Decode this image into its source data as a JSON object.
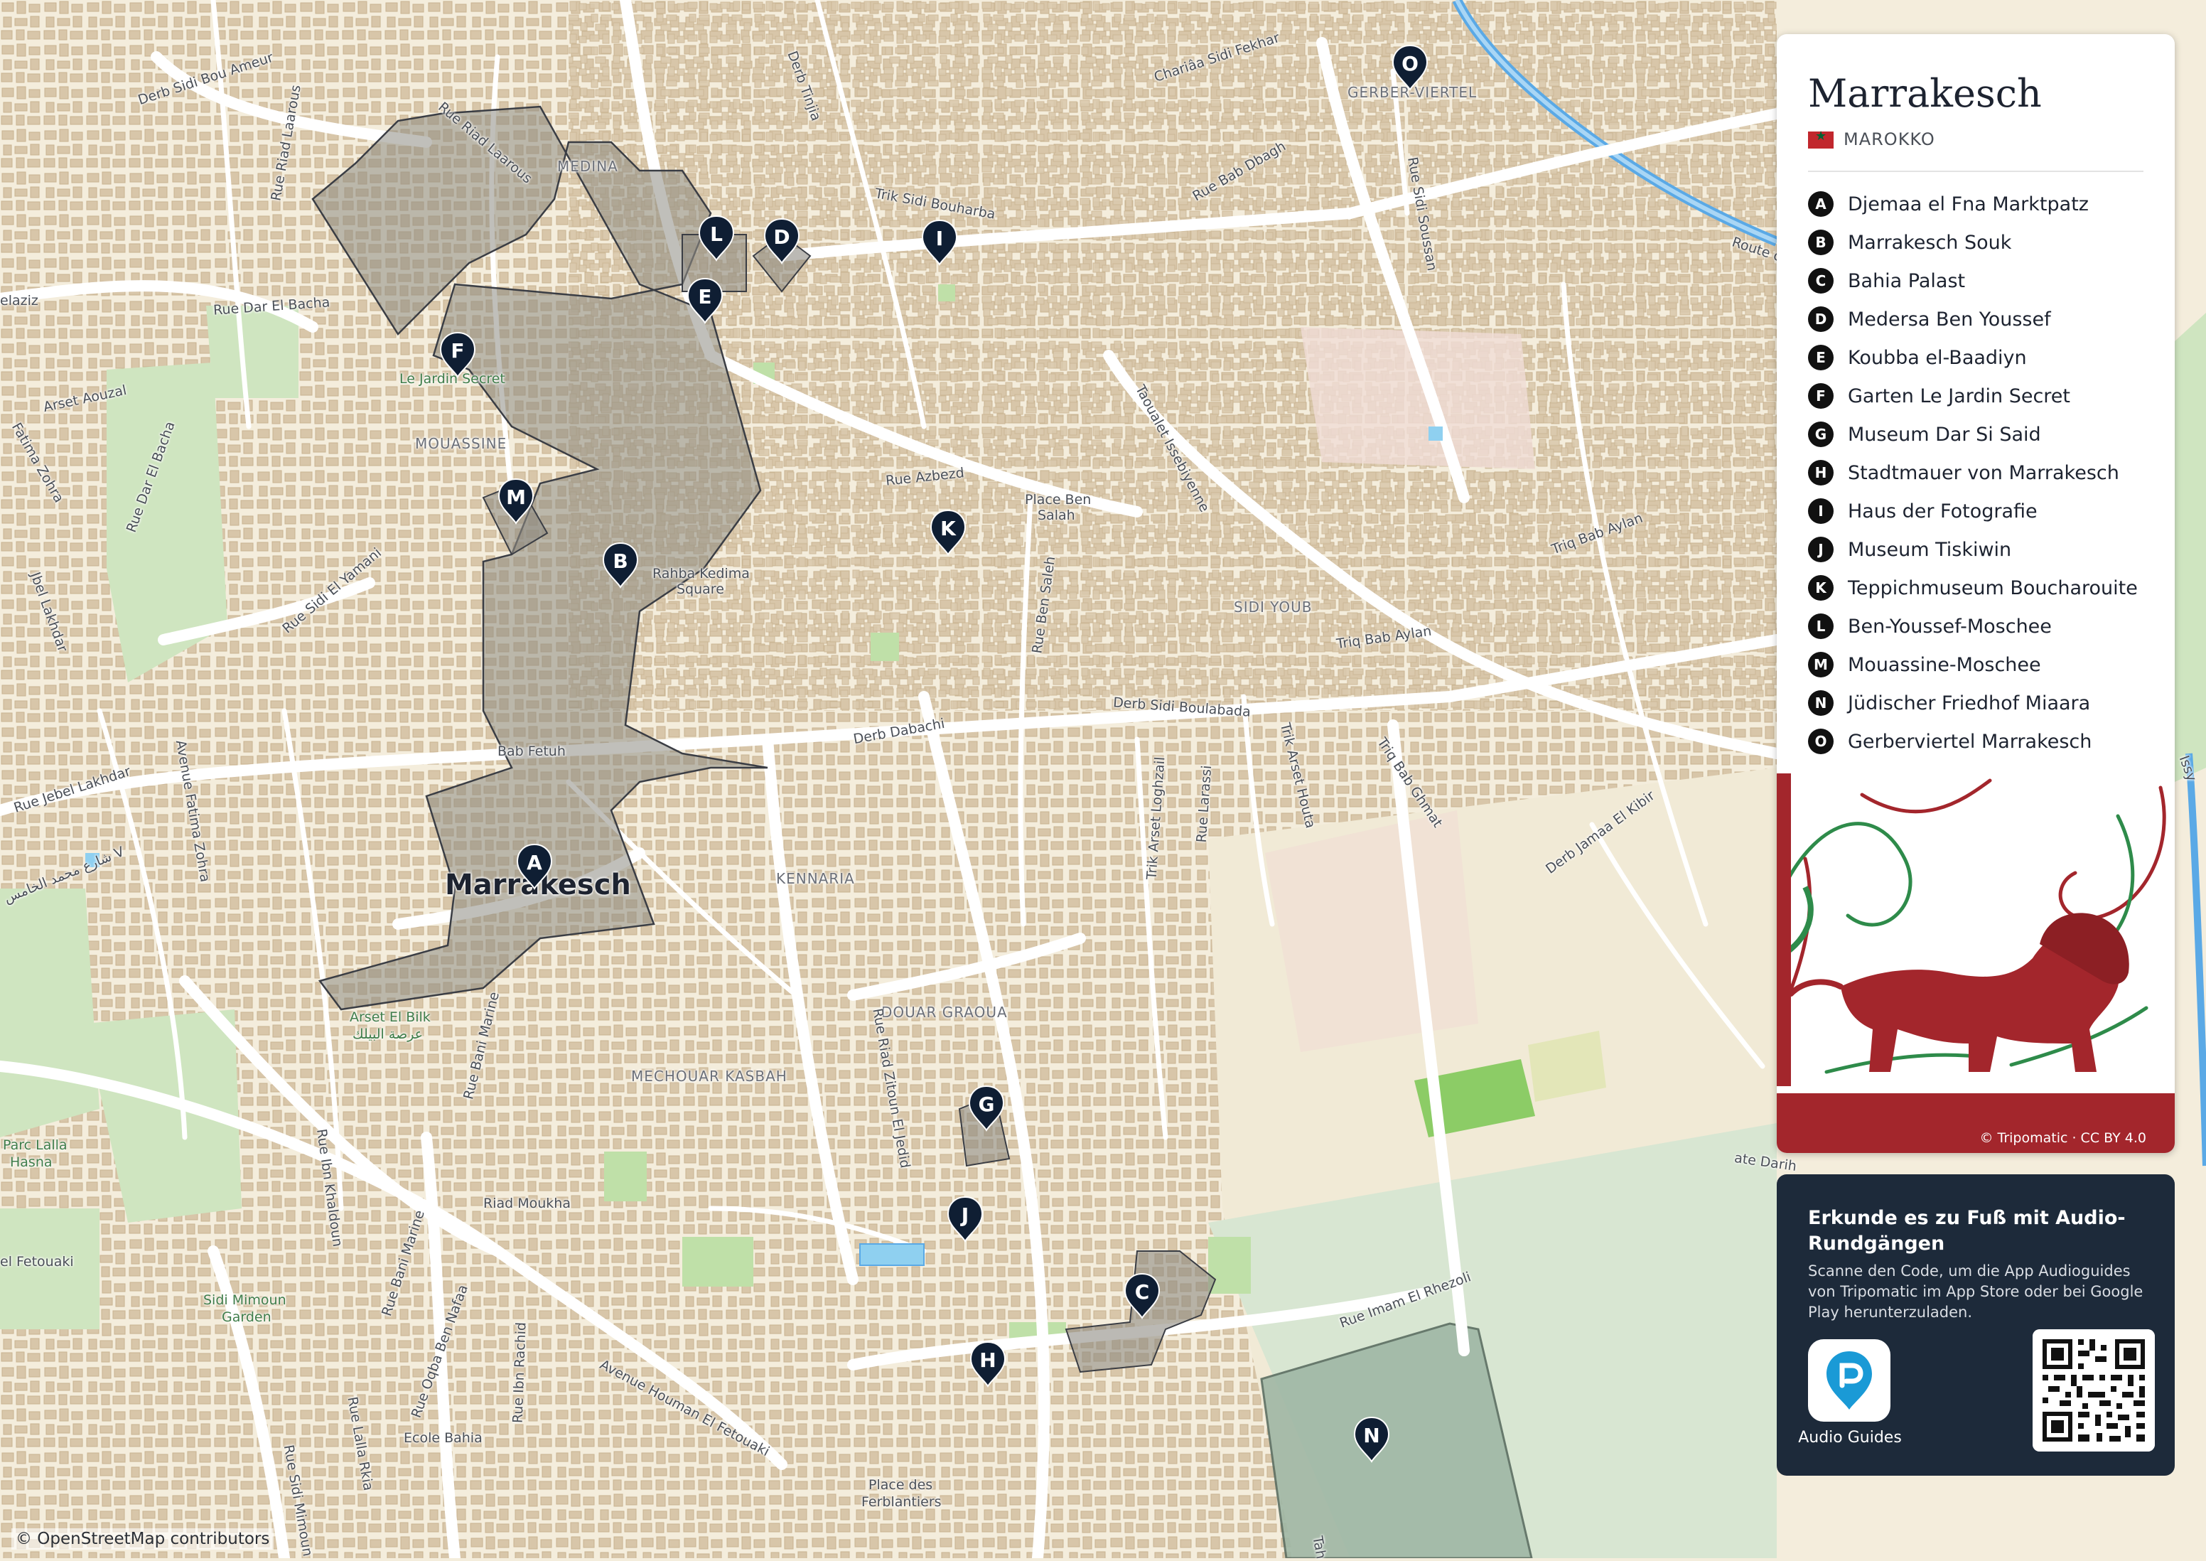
{
  "colors": {
    "land": "#f4eddc",
    "building": "#d5c1a3",
    "road": "#ffffff",
    "park": "#cfe5c0",
    "water": "#8fd0f0",
    "river": "#5aa9e6",
    "highlight_area": "#8d8a82",
    "cemetery": "#9fb7a5",
    "pin": "#0f1e33",
    "promo_bg": "#1d2a3a",
    "flag": "#c1272d"
  },
  "title": "Marrakesch",
  "country": "MAROKKO",
  "city_label": "Marrakesch",
  "pois": [
    {
      "letter": "A",
      "name": "Djemaa el Fna Marktpatz"
    },
    {
      "letter": "B",
      "name": "Marrakesch Souk"
    },
    {
      "letter": "C",
      "name": "Bahia Palast"
    },
    {
      "letter": "D",
      "name": "Medersa Ben Youssef"
    },
    {
      "letter": "E",
      "name": "Koubba el-Baadiyn"
    },
    {
      "letter": "F",
      "name": "Garten Le Jardin Secret"
    },
    {
      "letter": "G",
      "name": "Museum Dar Si Said"
    },
    {
      "letter": "H",
      "name": "Stadtmauer von Marrakesch"
    },
    {
      "letter": "I",
      "name": "Haus der Fotografie"
    },
    {
      "letter": "J",
      "name": "Museum Tiskiwin"
    },
    {
      "letter": "K",
      "name": "Teppichmuseum Boucharouite"
    },
    {
      "letter": "L",
      "name": "Ben-Youssef-Moschee"
    },
    {
      "letter": "M",
      "name": "Mouassine-Moschee"
    },
    {
      "letter": "N",
      "name": "Jüdischer Friedhof Miaara"
    },
    {
      "letter": "O",
      "name": "Gerberviertel Marrakesch"
    }
  ],
  "map_labels": {
    "medina": "MEDINA",
    "mouassine": "MOUASSINE",
    "sidi_youb": "SIDI YOUB",
    "kennaria": "KENNARIA",
    "douar_graoua": "DOUAR GRAOUA",
    "mechouar_kasbah": "MECHOUAR KASBAH",
    "gerber_viertel": "GERBER-VIERTEL",
    "le_jardin_secret": "Le Jardin Secret",
    "rahba_kedima_1": "Rahba Kedima",
    "rahba_kedima_2": "Square",
    "bab_fetuh": "Bab Fetuh",
    "arset_el_bilk": "Arset El Bilk",
    "arset_el_bilk_ar": "عرصة البيلك",
    "parc_lalla_hasna_1": "Parc Lalla",
    "parc_lalla_hasna_2": "Hasna",
    "riad_moukha": "Riad Moukha",
    "sidi_mimoun_garden_1": "Sidi Mimoun",
    "sidi_mimoun_garden_2": "Garden",
    "ecole_bahia": "Ecole Bahia",
    "place_des_ferblantiers_1": "Place des",
    "place_des_ferblantiers_2": "Ferblantiers",
    "place_ben_salah_1": "Place Ben",
    "place_ben_salah_2": "Salah",
    "derb_sidi_bou_ameur": "Derb Sidi Bou Ameur",
    "rue_riad_laarous": "Rue Riad Laarous",
    "rue_riad_laarous_2": "Rue Riad Laarous",
    "derb_tinjia": "Derb Tinjia",
    "chariaa_sidi_fekhar": "Chariâa Sidi Fekhar",
    "rue_bab_dbagh": "Rue Bab Dbagh",
    "trik_sidi_bouharba": "Trik Sidi Bouharba",
    "rue_sidi_soussan": "Rue Sidi Soussan",
    "route": "Route c",
    "rue_dar_el_bacha": "Rue Dar El Bacha",
    "elaziz": "elaziz",
    "arset_aouzal": "Arset Aouzal",
    "fatima_zohra": "Fatima Zohra",
    "rue_dar_el_bacha_2": "Rue Dar El Bacha",
    "jbel_lakhdar": "Jbel Lakhdar",
    "rue_sidi_el_yamani": "Rue Sidi El Yamani",
    "rue_azbezd": "Rue Azbezd",
    "taoualet_issebiyenne": "Taoualet Issebiyenne",
    "triq_bab_aylan": "Triq Bab Aylan",
    "triq_bab_aylan_2": "Triq Bab Aylan",
    "rue_ben_saleh": "Rue Ben Saleh",
    "derb_sidi_boulabada": "Derb Sidi Boulabada",
    "derb_dabachi": "Derb Dabachi",
    "rue_jebel_lakhdar": "Rue Jebel Lakhdar",
    "avenue_fatima_zohra": "Avenue Fatima Zohra",
    "arabic_street": "شارع محمد الخامس V",
    "trik_arset_loghzail": "Trik Arset Loghzail",
    "rue_larassi": "Rue Larassi",
    "trik_arset_houta": "Trik Arset Houta",
    "triq_bab_ghmat": "Triq Bab Ghmat",
    "derb_jamaa_el_kibir": "Derb Jamaa El Kibir",
    "rue_bani_marine": "Rue Bani Marine",
    "rue_riad_zitoun_el_jedid": "Rue Riad Zitoun El Jedid",
    "rue_ibn_khaldoun": "Rue Ibn Khaldoun",
    "el_fetouaki": "el Fetouaki",
    "rue_bani_marine_2": "Rue Bani Marine",
    "rue_oqba_ben_nafaa": "Rue Oqba Ben Nafaa",
    "rue_ibn_rachid": "Rue Ibn Rachid",
    "avenue_houman_el_fetouaki": "Avenue Houman El Fetouaki",
    "rue_lalla_rkia": "Rue Lalla Rkia",
    "rue_sidi_mimoun": "Rue Sidi Mimoun",
    "rue_imam_el_rhezoli": "Rue Imam El Rhezoli",
    "tah": "Tah",
    "ate_darih": "ate Darih",
    "issy": "Issy",
    "route_label_right": "Route c"
  },
  "attribution_osm": "© OpenStreetMap contributors",
  "attribution_art": "© Tripomatic · CC BY 4.0",
  "promo": {
    "heading": "Erkunde es zu Fuß mit Audio-Rundgängen",
    "text": "Scanne den Code, um die App Audioguides von Tripomatic im App Store oder bei Google Play herunterzuladen.",
    "app_label": "Audio Guides"
  }
}
